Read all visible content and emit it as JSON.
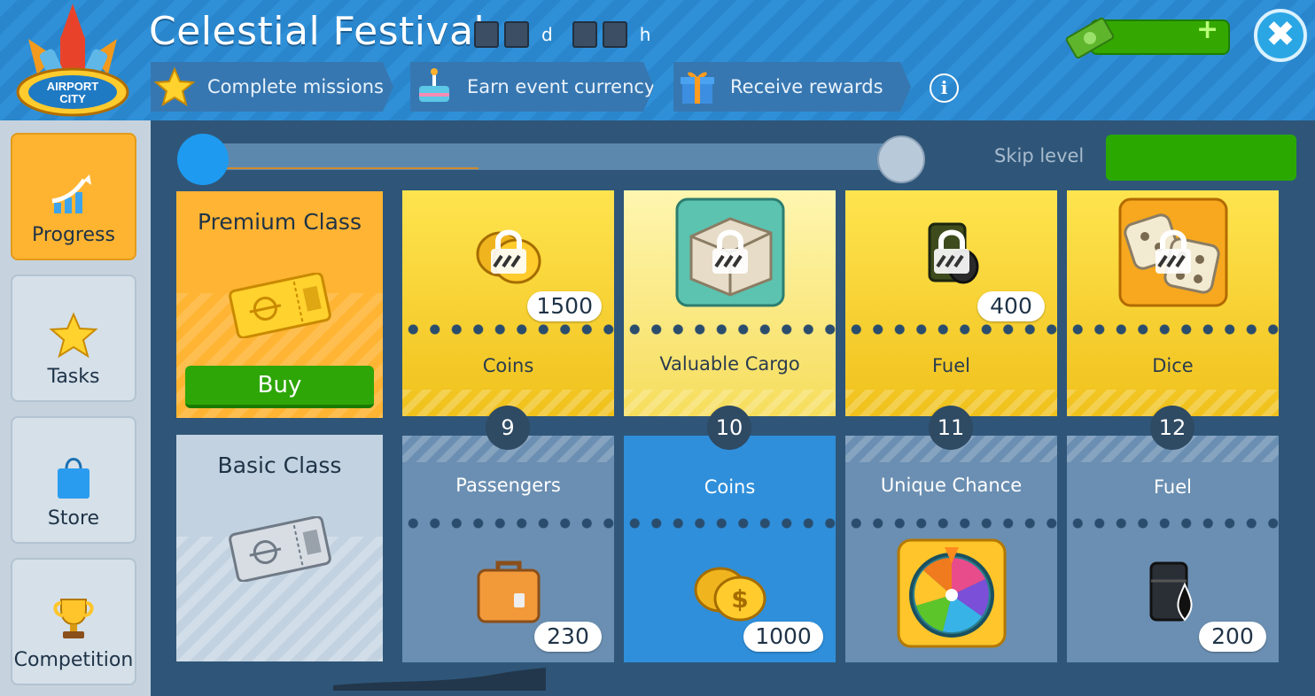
{
  "header": {
    "title": "Celestial Festival",
    "timer_days_unit": "d",
    "timer_hours_unit": "h",
    "logo_text": [
      "AIRPORT",
      "CITY"
    ],
    "steps": [
      {
        "label": "Complete missions",
        "icon": "star-icon"
      },
      {
        "label": "Earn event currency",
        "icon": "cake-icon"
      },
      {
        "label": "Receive rewards",
        "icon": "gift-icon"
      }
    ],
    "info_label": "i",
    "close_label": "✖",
    "cash_plus": "+"
  },
  "sidebar": {
    "items": [
      {
        "label": "Progress",
        "icon": "progress-chart-icon",
        "active": true
      },
      {
        "label": "Tasks",
        "icon": "star-icon",
        "active": false
      },
      {
        "label": "Store",
        "icon": "shopping-bag-icon",
        "active": false
      },
      {
        "label": "Competition",
        "icon": "trophy-icon",
        "active": false
      }
    ]
  },
  "progress": {
    "skip_label": "Skip level"
  },
  "classes": {
    "premium": {
      "title": "Premium Class",
      "buy_label": "Buy"
    },
    "basic": {
      "title": "Basic Class"
    }
  },
  "levels": [
    {
      "level": "9",
      "premium": {
        "name": "Coins",
        "qty": "1500",
        "icon": "coins-icon",
        "locked": true
      },
      "basic": {
        "name": "Passengers",
        "qty": "230",
        "icon": "suitcase-icon"
      }
    },
    {
      "level": "10",
      "premium": {
        "name": "Valuable Cargo",
        "qty": "",
        "icon": "cargo-container-icon",
        "locked": true
      },
      "basic": {
        "name": "Coins",
        "qty": "1000",
        "icon": "coins-icon",
        "highlighted": true
      }
    },
    {
      "level": "11",
      "premium": {
        "name": "Fuel",
        "qty": "400",
        "icon": "fuel-barrel-icon",
        "locked": true
      },
      "basic": {
        "name": "Unique Chance",
        "qty": "",
        "icon": "fortune-wheel-icon"
      }
    },
    {
      "level": "12",
      "premium": {
        "name": "Dice",
        "qty": "",
        "icon": "dice-icon",
        "locked": true
      },
      "basic": {
        "name": "Fuel",
        "qty": "200",
        "icon": "fuel-barrel-icon"
      }
    }
  ],
  "colors": {
    "header_blue": "#2f90d8",
    "premium_yellow": "#ffe44f",
    "basic_blue": "#6b8fb2",
    "highlight_blue": "#2f8fdb",
    "green_button": "#2ea608",
    "active_tab": "#ffb431"
  }
}
